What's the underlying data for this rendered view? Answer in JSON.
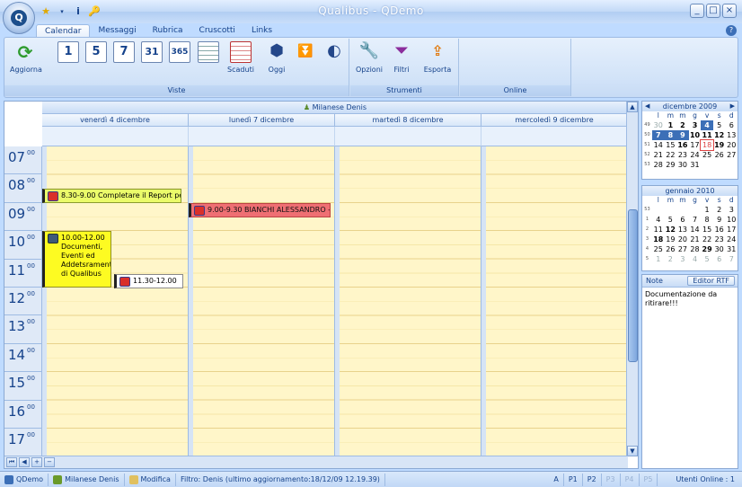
{
  "window": {
    "title": "Qualibus  -  QDemo",
    "buttons": [
      "_",
      "□",
      "×"
    ]
  },
  "app_orb_glyph": "Q",
  "quick_access": [
    "★",
    "▾",
    "i",
    "🔑"
  ],
  "ribbon": {
    "tabs": [
      "Calendar",
      "Messaggi",
      "Rubrica",
      "Cruscotti",
      "Links"
    ],
    "active_tab": "Calendar",
    "groups": {
      "viste": {
        "label": "Viste",
        "aggiorna": "Aggiorna",
        "views": [
          "1",
          "5",
          "7",
          "31",
          "365"
        ],
        "scaduti": "Scaduti"
      },
      "oggi": {
        "label": "Oggi"
      },
      "strumenti": {
        "label": "Strumenti",
        "opzioni": "Opzioni",
        "filtri": "Filtri",
        "esporta": "Esporta"
      },
      "online": {
        "label": "Online"
      }
    }
  },
  "calendar": {
    "resource": "Milanese Denis",
    "days": [
      "venerdì 4 dicembre",
      "lunedì 7 dicembre",
      "martedì 8 dicembre",
      "mercoledì 9 dicembre"
    ],
    "hours": [
      "07",
      "08",
      "09",
      "10",
      "11",
      "12",
      "13",
      "14",
      "15",
      "16",
      "17"
    ],
    "minutes": "00",
    "appointments": [
      {
        "text": "8.30-9.00 Completare il Report per",
        "day": 0,
        "start": 8.5,
        "end": 9.0,
        "color": "green"
      },
      {
        "text": "9.00-9.30 BIANCHI ALESSANDRO -",
        "day": 1,
        "start": 9.0,
        "end": 9.5,
        "color": "red"
      },
      {
        "text": "10.00-12.00 Documenti, Eventi ed Addetsramenti di Qualibus",
        "day": 0,
        "start": 10.0,
        "end": 12.0,
        "color": "yellow"
      },
      {
        "text": "11.30-12.00",
        "day": 0,
        "start": 11.5,
        "end": 12.0,
        "color": "white"
      }
    ]
  },
  "mini_calendars": [
    {
      "month": "dicembre 2009",
      "dow": [
        "l",
        "m",
        "m",
        "g",
        "v",
        "s",
        "d"
      ],
      "weeks": [
        {
          "wk": "49",
          "days": [
            "30",
            "1",
            "2",
            "3",
            "4",
            "5",
            "6"
          ]
        },
        {
          "wk": "50",
          "days": [
            "7",
            "8",
            "9",
            "10",
            "11",
            "12",
            "13"
          ]
        },
        {
          "wk": "51",
          "days": [
            "14",
            "15",
            "16",
            "17",
            "18",
            "19",
            "20"
          ]
        },
        {
          "wk": "52",
          "days": [
            "21",
            "22",
            "23",
            "24",
            "25",
            "26",
            "27"
          ]
        },
        {
          "wk": "53",
          "days": [
            "28",
            "29",
            "30",
            "31",
            "",
            "",
            ""
          ]
        }
      ]
    },
    {
      "month": "gennaio 2010",
      "dow": [
        "l",
        "m",
        "m",
        "g",
        "v",
        "s",
        "d"
      ],
      "weeks": [
        {
          "wk": "53",
          "days": [
            "",
            "",
            "",
            "",
            "1",
            "2",
            "3"
          ]
        },
        {
          "wk": "1",
          "days": [
            "4",
            "5",
            "6",
            "7",
            "8",
            "9",
            "10"
          ]
        },
        {
          "wk": "2",
          "days": [
            "11",
            "12",
            "13",
            "14",
            "15",
            "16",
            "17"
          ]
        },
        {
          "wk": "3",
          "days": [
            "18",
            "19",
            "20",
            "21",
            "22",
            "23",
            "24"
          ]
        },
        {
          "wk": "4",
          "days": [
            "25",
            "26",
            "27",
            "28",
            "29",
            "30",
            "31"
          ]
        },
        {
          "wk": "5",
          "days": [
            "1",
            "2",
            "3",
            "4",
            "5",
            "6",
            "7"
          ]
        }
      ]
    }
  ],
  "notes": {
    "title": "Note",
    "editor_button": "Editor RTF",
    "text": "Documentazione da ritirare!!!"
  },
  "status": {
    "app": "QDemo",
    "user": "Milanese Denis",
    "modifica": "Modifica",
    "filter": "Filtro: Denis  (ultimo aggiornamento:18/12/09 12.19.39)",
    "indicators": [
      "A",
      "P1",
      "P2",
      "P3",
      "P4",
      "P5"
    ],
    "online": "Utenti Online : 1"
  },
  "colors": {
    "accent": "#15428b",
    "selected_day": "#3c6fb7",
    "workhour_bg": "#fff6c9"
  }
}
